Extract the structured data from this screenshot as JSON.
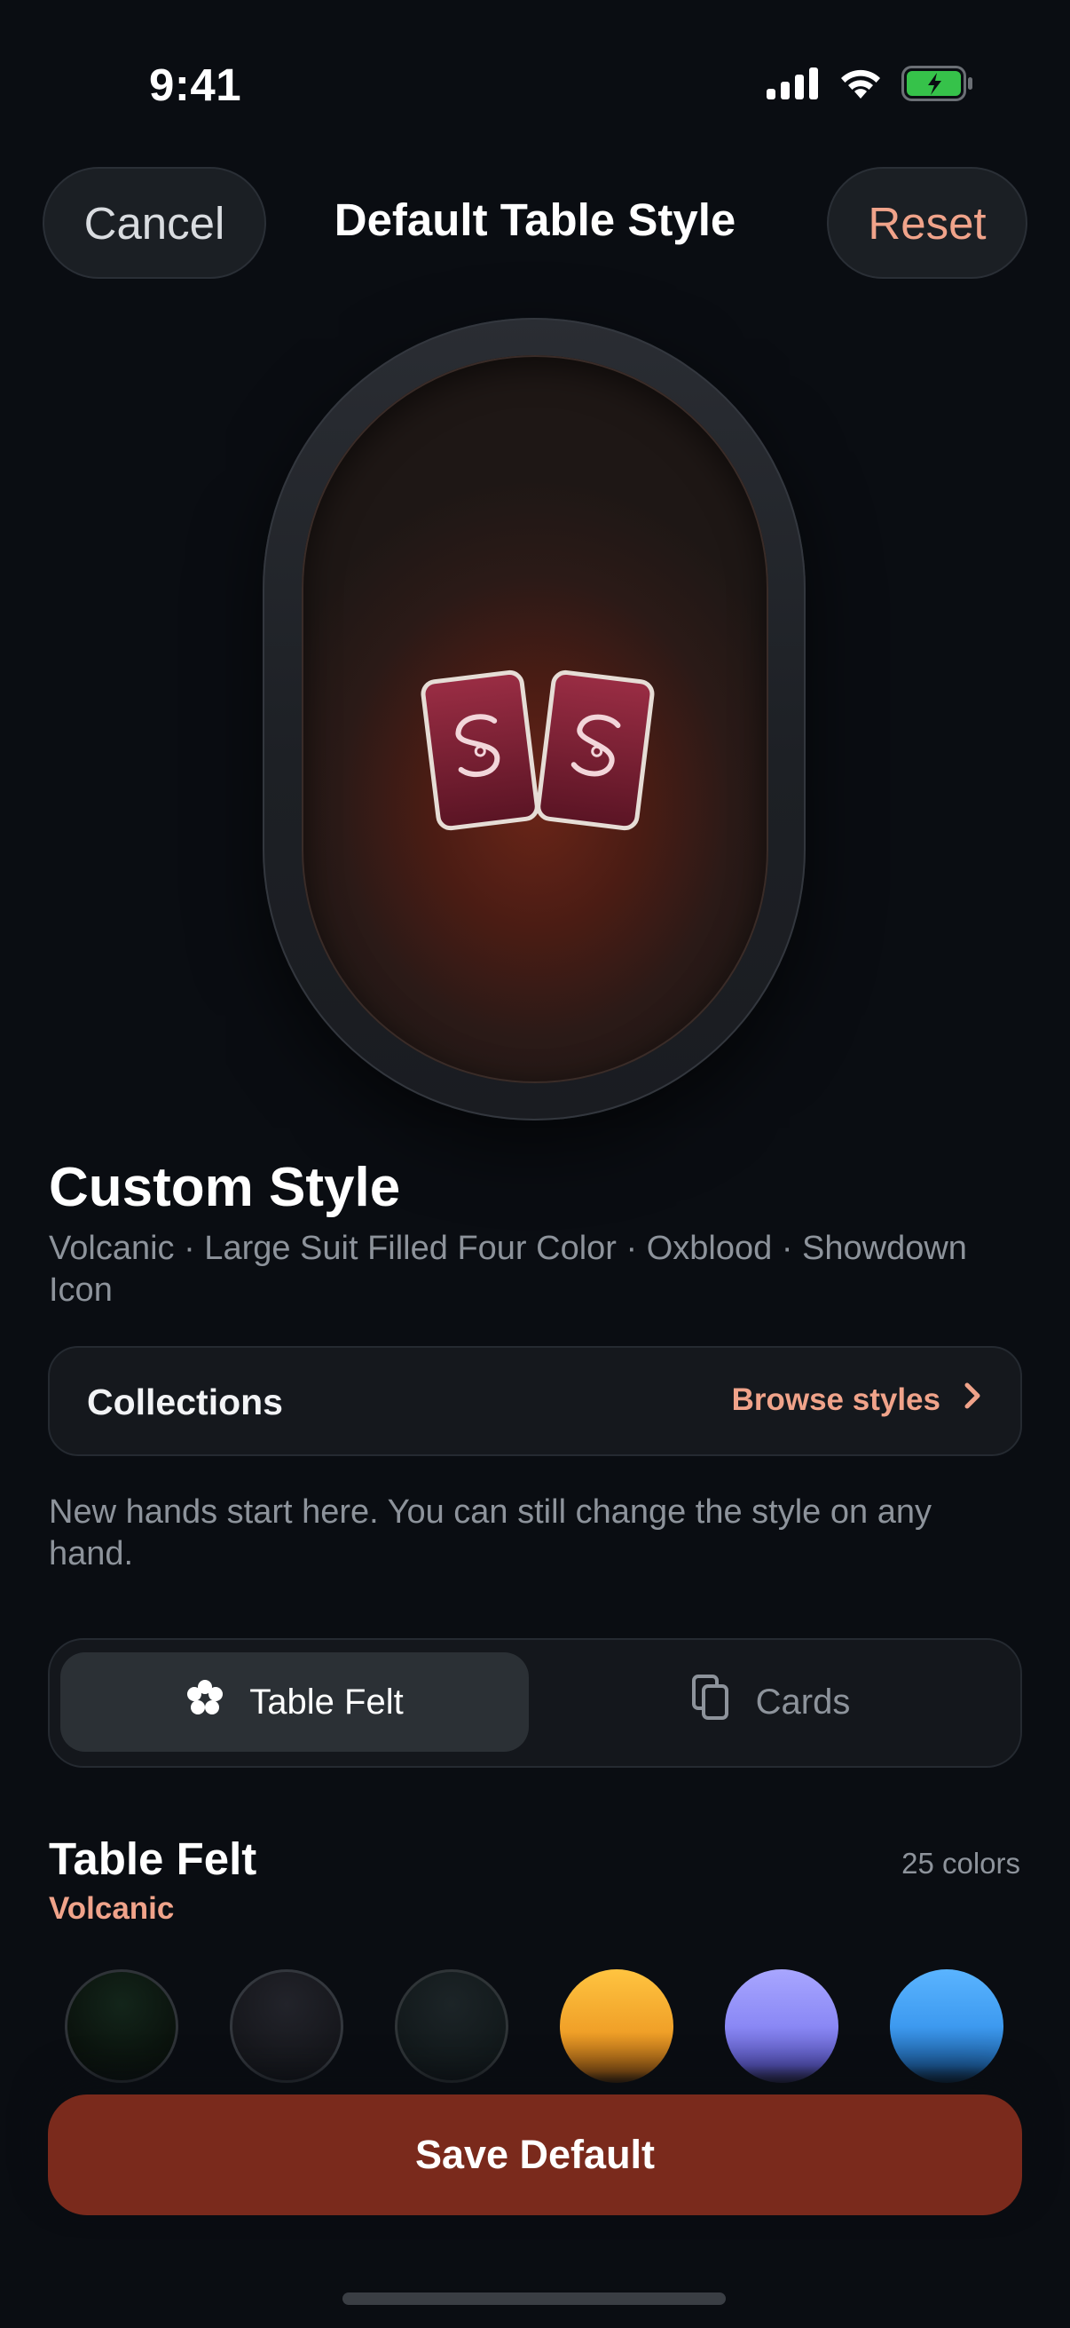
{
  "status_bar": {
    "time": "9:41",
    "icons": [
      "cellular-signal-icon",
      "wifi-icon",
      "battery-charging-icon"
    ]
  },
  "header": {
    "cancel_label": "Cancel",
    "title": "Default Table Style",
    "reset_label": "Reset"
  },
  "preview": {
    "card_icon": "showdown-icon"
  },
  "style": {
    "name": "Custom Style",
    "summary": "Volcanic · Large Suit Filled Four Color · Oxblood · Showdown Icon"
  },
  "collections": {
    "label": "Collections",
    "link_label": "Browse styles",
    "link_icon": "chevron-right-icon"
  },
  "helper_text": "New hands start here. You can still change the style on any hand.",
  "segments": [
    {
      "label": "Table Felt",
      "icon": "felt-icon",
      "selected": true
    },
    {
      "label": "Cards",
      "icon": "cards-icon",
      "selected": false
    }
  ],
  "felt": {
    "title": "Table Felt",
    "selected_name": "Volcanic",
    "count_label": "25 colors",
    "swatch_colors": [
      "#0d1a12",
      "#16171c",
      "#131a1c",
      "#f0a028",
      "#8a88f5",
      "#3d9af0"
    ]
  },
  "save_label": "Save Default",
  "colors": {
    "accent": "#f0a38a",
    "save_button": "#7a2a1c",
    "background": "#0a0d12"
  }
}
